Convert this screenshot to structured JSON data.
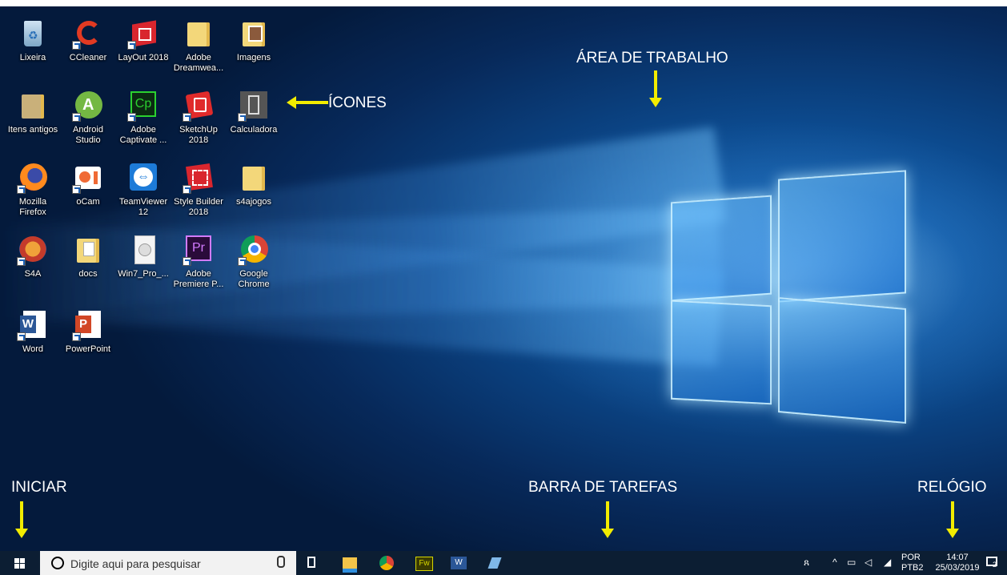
{
  "desktop": {
    "icons": [
      {
        "label": "Lixeira"
      },
      {
        "label": "CCleaner"
      },
      {
        "label": "LayOut 2018"
      },
      {
        "label": "Adobe Dreamwea..."
      },
      {
        "label": "Imagens"
      },
      {
        "label": "Itens antigos"
      },
      {
        "label": "Android Studio"
      },
      {
        "label": "Adobe Captivate ..."
      },
      {
        "label": "SketchUp 2018"
      },
      {
        "label": "Calculadora"
      },
      {
        "label": "Mozilla Firefox"
      },
      {
        "label": "oCam"
      },
      {
        "label": "TeamViewer 12"
      },
      {
        "label": "Style Builder 2018"
      },
      {
        "label": "s4ajogos"
      },
      {
        "label": "S4A"
      },
      {
        "label": "docs"
      },
      {
        "label": "Win7_Pro_..."
      },
      {
        "label": "Adobe Premiere P..."
      },
      {
        "label": "Google Chrome"
      },
      {
        "label": "Word"
      },
      {
        "label": "PowerPoint"
      }
    ]
  },
  "annotations": {
    "area_de_trabalho": "ÁREA DE TRABALHO",
    "icones": "ÍCONES",
    "iniciar": "INICIAR",
    "barra_de_tarefas": "BARRA DE TAREFAS",
    "relogio": "RELÓGIO"
  },
  "taskbar": {
    "search_placeholder": "Digite aqui para pesquisar",
    "language_top": "POR",
    "language_bottom": "PTB2",
    "time": "14:07",
    "date": "25/03/2019",
    "notification_count": "2"
  },
  "colors": {
    "annotation_arrow": "#f2ec00",
    "taskbar": "#0c1e33",
    "wallpaper_accent": "#1a6fc4"
  }
}
